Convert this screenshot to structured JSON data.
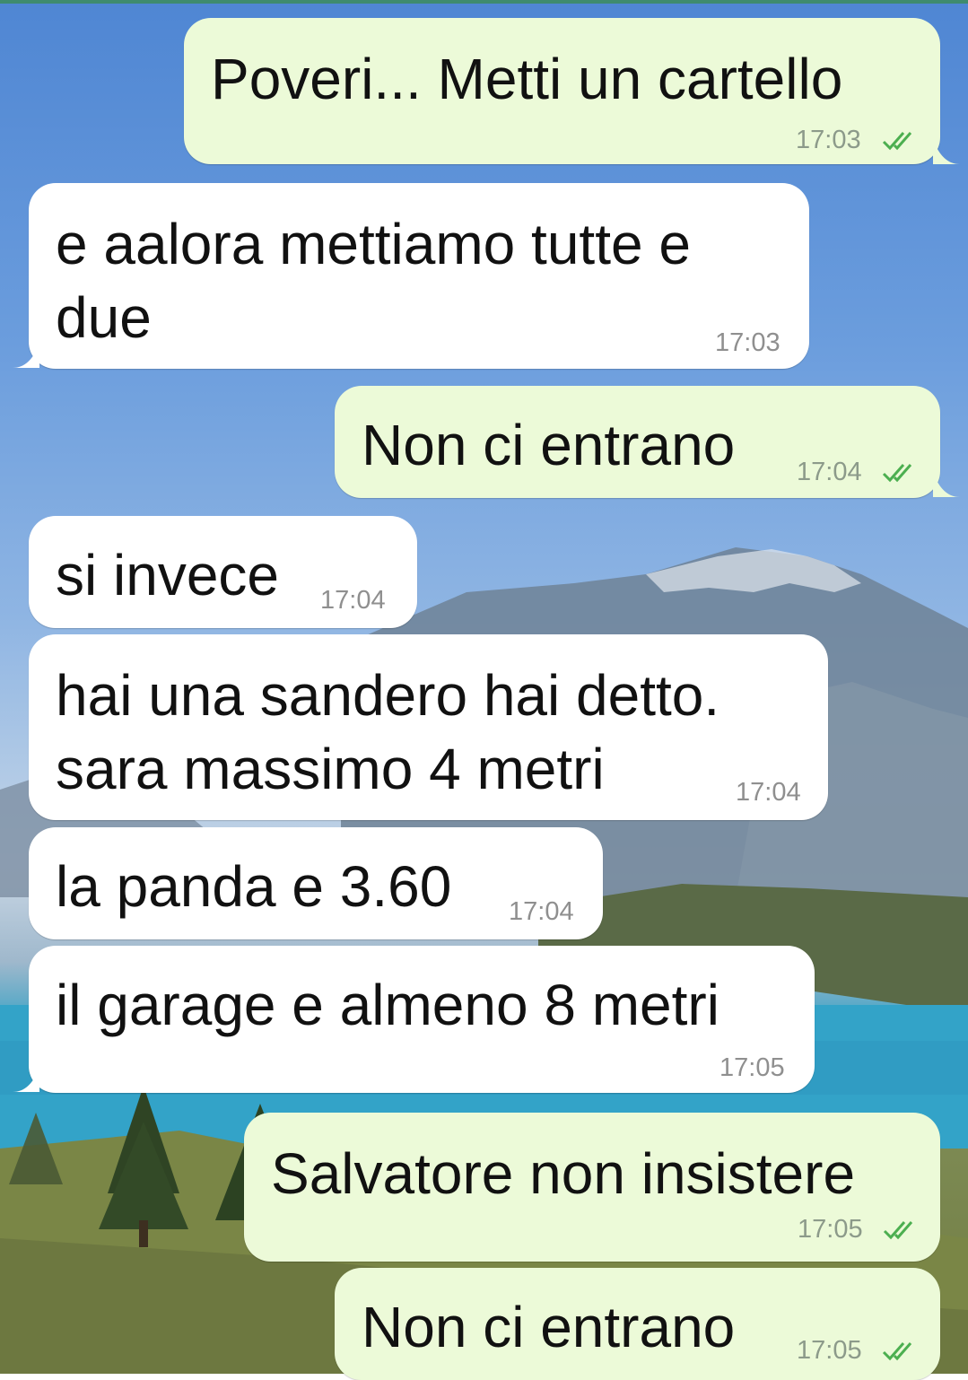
{
  "conversation": {
    "messages": [
      {
        "direction": "outgoing",
        "text": "Poveri... Metti un cartello",
        "time": "17:03",
        "status_icon": "double-check-icon"
      },
      {
        "direction": "incoming",
        "text_lines": [
          "e aalora mettiamo tutte e",
          "due"
        ],
        "time": "17:03"
      },
      {
        "direction": "outgoing",
        "text": "Non ci entrano",
        "time": "17:04",
        "status_icon": "double-check-icon"
      },
      {
        "direction": "incoming",
        "text": "si invece",
        "time": "17:04"
      },
      {
        "direction": "incoming",
        "text_lines": [
          "hai una sandero hai detto.",
          "sara massimo 4 metri"
        ],
        "time": "17:04"
      },
      {
        "direction": "incoming",
        "text": "la panda e 3.60",
        "time": "17:04"
      },
      {
        "direction": "incoming",
        "text": "il garage e almeno 8 metri",
        "time": "17:05"
      },
      {
        "direction": "outgoing",
        "text": "Salvatore non insistere",
        "time": "17:05",
        "status_icon": "double-check-icon"
      },
      {
        "direction": "outgoing",
        "text": "Non ci entrano",
        "time": "17:05",
        "status_icon": "double-check-icon"
      }
    ]
  },
  "colors": {
    "outgoing_bubble": "#ecfad8",
    "incoming_bubble": "#ffffff",
    "read_tick": "#4caf50",
    "timestamp": "#8c9a8a"
  },
  "wallpaper": {
    "description_icon": "mountain-lake-wallpaper"
  }
}
